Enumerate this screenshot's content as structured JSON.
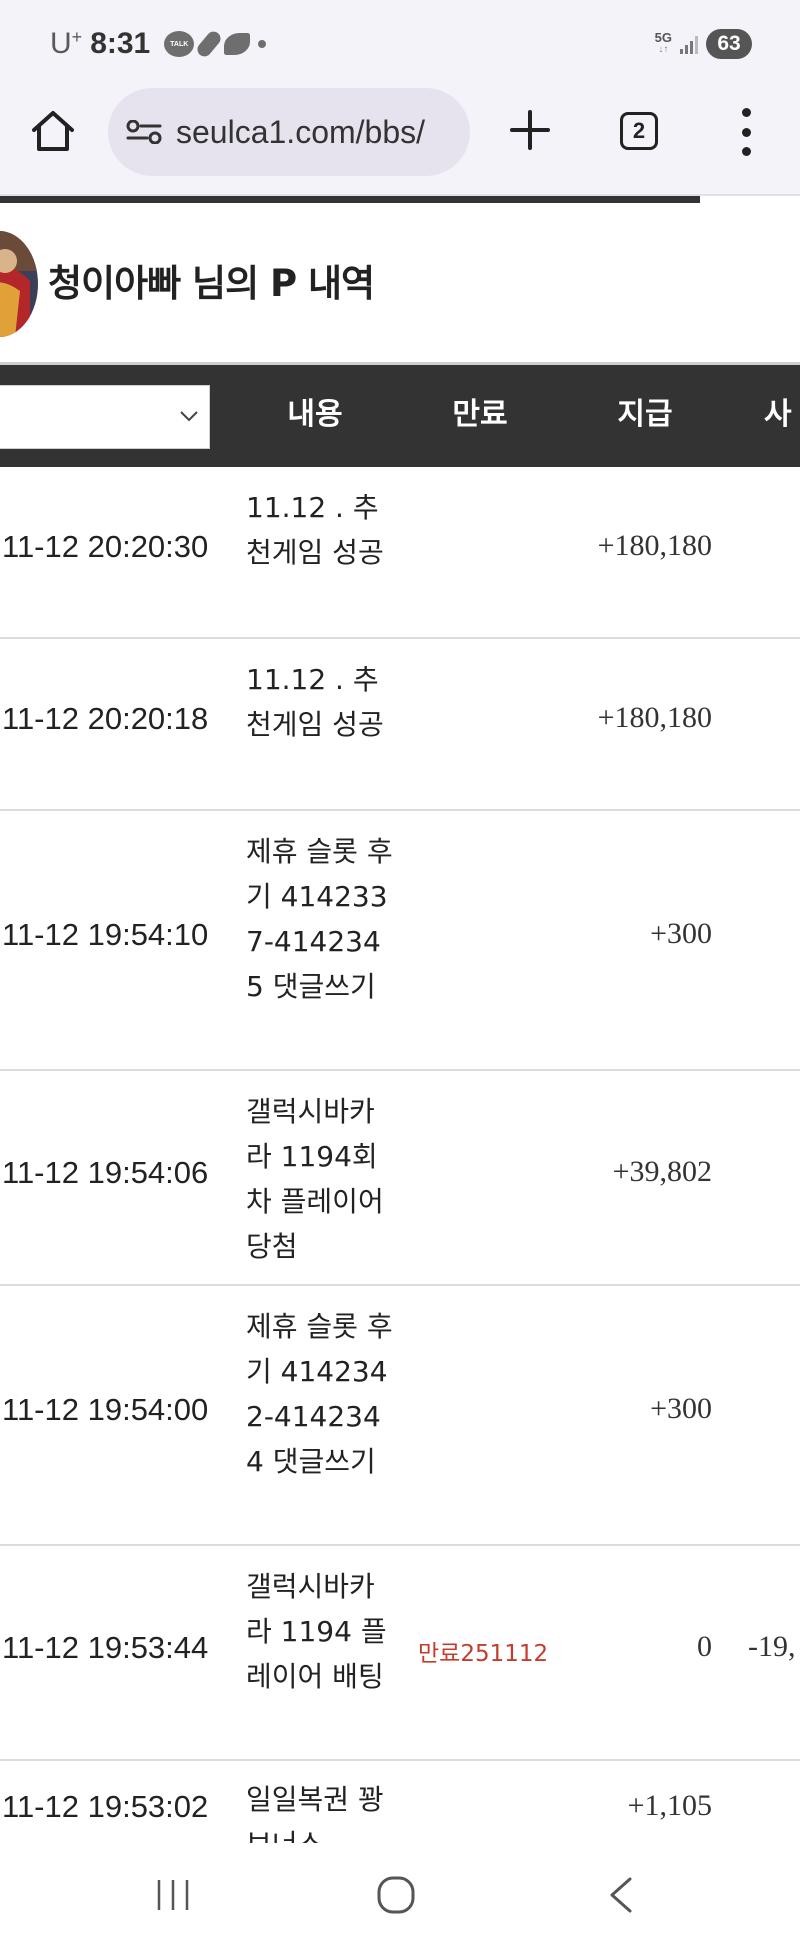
{
  "status_bar": {
    "carrier": "U",
    "carrier_sup": "+",
    "time": "8:31",
    "talk_label": "TALK",
    "network": "5G",
    "network_arrows": "↓↑",
    "battery": "63"
  },
  "browser": {
    "url": "seulca1.com/bbs/",
    "tab_count": "2"
  },
  "page": {
    "title": "청이아빠 님의 P 내역",
    "filter_value": "",
    "columns": {
      "content": "내용",
      "expiry": "만료",
      "paid": "지급",
      "used": "사"
    },
    "rows": [
      {
        "date": "11-12 20:20:30",
        "content": "11.12 . 추천게임 성공",
        "expiry": "",
        "paid": "+180,180",
        "used": ""
      },
      {
        "date": "11-12 20:20:18",
        "content": "11.12 . 추천게임 성공",
        "expiry": "",
        "paid": "+180,180",
        "used": ""
      },
      {
        "date": "11-12 19:54:10",
        "content": "제휴 슬롯 후기 4142337-4142345 댓글쓰기",
        "expiry": "",
        "paid": "+300",
        "used": ""
      },
      {
        "date": "11-12 19:54:06",
        "content": "갤럭시바카라 1194회차 플레이어당첨",
        "expiry": "",
        "paid": "+39,802",
        "used": ""
      },
      {
        "date": "11-12 19:54:00",
        "content": "제휴 슬롯 후기 4142342-4142344 댓글쓰기",
        "expiry": "",
        "paid": "+300",
        "used": ""
      },
      {
        "date": "11-12 19:53:44",
        "content": "갤럭시바카라 1194 플레이어 배팅",
        "expiry": "만료251112",
        "paid": "0",
        "used": "-19,"
      },
      {
        "date": "11-12 19:53:02",
        "content": "일일복권 꽝 보너스",
        "expiry": "",
        "paid": "+1,105",
        "used": ""
      }
    ]
  },
  "colors": {
    "header_bg": "#333333",
    "expiry_text": "#c43c2c",
    "browser_bg": "#f5f3fa",
    "url_bg": "#e6e3ee"
  },
  "icons": {
    "home": "home-icon",
    "site_info": "tune-icon",
    "new_tab": "plus-icon",
    "menu": "more-vert-icon",
    "nav_recent": "recent-apps-icon",
    "nav_home": "home-circle-icon",
    "nav_back": "back-chevron-icon"
  }
}
